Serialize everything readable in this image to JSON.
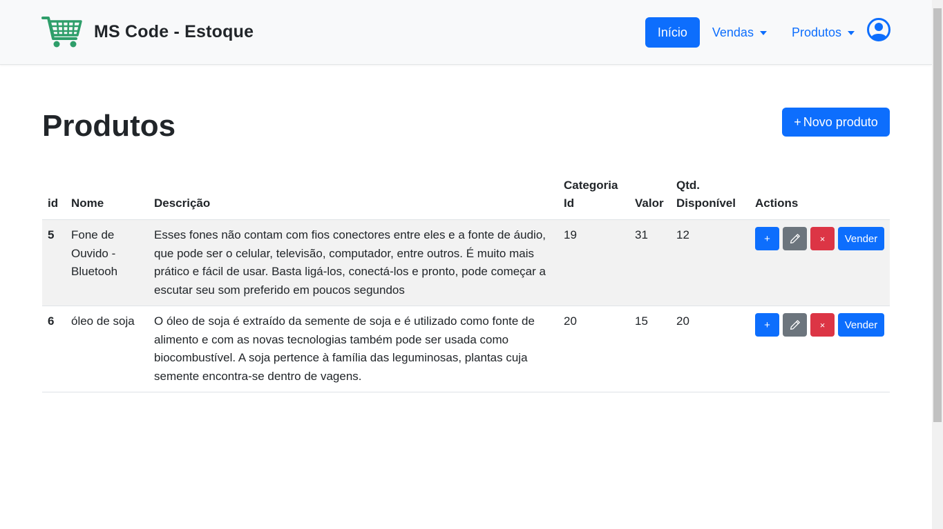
{
  "navbar": {
    "brand": "MS Code - Estoque",
    "inicio_label": "Início",
    "vendas_label": "Vendas",
    "produtos_label": "Produtos",
    "user_icon": "user-circle-icon",
    "brand_icon": "shopping-cart-icon"
  },
  "page": {
    "title": "Produtos",
    "new_button_plus": "+",
    "new_button_label": "Novo produto"
  },
  "table": {
    "headers": {
      "id": "id",
      "nome": "Nome",
      "descricao": "Descrição",
      "categoria_line1": "Categoria",
      "categoria_line2": "Id",
      "valor": "Valor",
      "qtd_line1": "Qtd.",
      "qtd_line2": "Disponível",
      "actions": "Actions"
    },
    "rows": [
      {
        "id": "5",
        "nome": "Fone de Ouvido - Bluetooh",
        "descricao": "Esses fones não contam com fios conectores entre eles e a fonte de áudio, que pode ser o celular, televisão, computador, entre outros. É muito mais prático e fácil de usar. Basta ligá-los, conectá-los e pronto, pode começar a escutar seu som preferido em poucos segundos",
        "categoria_id": "19",
        "valor": "31",
        "qtd": "12"
      },
      {
        "id": "6",
        "nome": "óleo de soja",
        "descricao": "O óleo de soja é extraído da semente de soja e é utilizado como fonte de alimento e com as novas tecnologias também pode ser usada como biocombustível. A soja pertence à família das leguminosas, plantas cuja semente encontra-se dentro de vagens.",
        "categoria_id": "20",
        "valor": "15",
        "qtd": "20"
      }
    ],
    "row_actions": {
      "add_label": "+",
      "edit_icon": "pencil-icon",
      "delete_label": "×",
      "sell_label": "Vender"
    }
  },
  "colors": {
    "primary": "#0d6efd",
    "secondary": "#6c757d",
    "danger": "#dc3545",
    "brand_cart": "#2e9e6a",
    "navbar_bg": "#f8f9fa",
    "stripe": "#f2f2f2"
  }
}
